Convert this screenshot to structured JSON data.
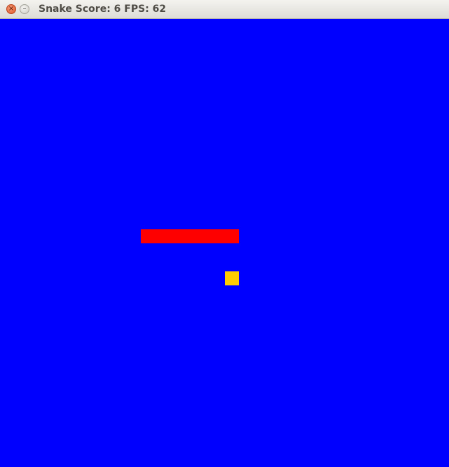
{
  "window": {
    "title": "Snake Score: 6 FPS: 62",
    "close_glyph": "×",
    "minimize_glyph": "–"
  },
  "game": {
    "score": 6,
    "fps": 62,
    "colors": {
      "board": "#0000ff",
      "snake": "#ff0000",
      "food": "#ffcc00"
    }
  }
}
